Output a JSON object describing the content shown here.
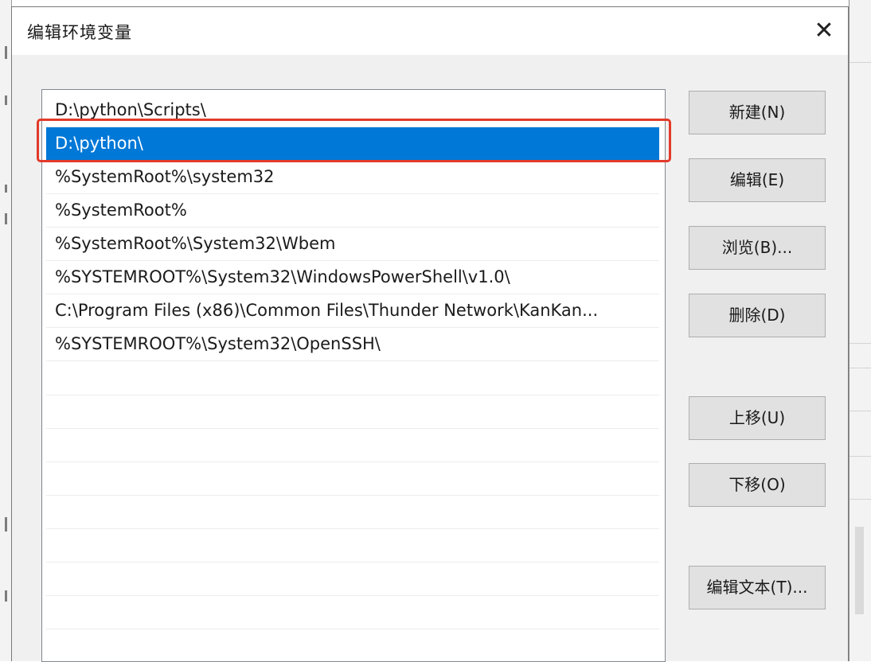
{
  "dialog": {
    "title": "编辑环境变量",
    "close_glyph": "✕"
  },
  "list": {
    "selected_index": 1,
    "items": [
      "D:\\python\\Scripts\\",
      "D:\\python\\",
      "%SystemRoot%\\system32",
      "%SystemRoot%",
      "%SystemRoot%\\System32\\Wbem",
      "%SYSTEMROOT%\\System32\\WindowsPowerShell\\v1.0\\",
      "C:\\Program Files (x86)\\Common Files\\Thunder Network\\KanKan...",
      "%SYSTEMROOT%\\System32\\OpenSSH\\"
    ]
  },
  "buttons": {
    "new": "新建(N)",
    "edit": "编辑(E)",
    "browse": "浏览(B)...",
    "delete": "删除(D)",
    "move_up": "上移(U)",
    "move_down": "下移(O)",
    "edit_text": "编辑文本(T)..."
  },
  "icons": {
    "close": "close-icon"
  },
  "colors": {
    "selection": "#0078d7",
    "highlight_border": "#e23a2a",
    "dialog_bg": "#f0f0f0",
    "button_bg": "#e1e1e1"
  }
}
